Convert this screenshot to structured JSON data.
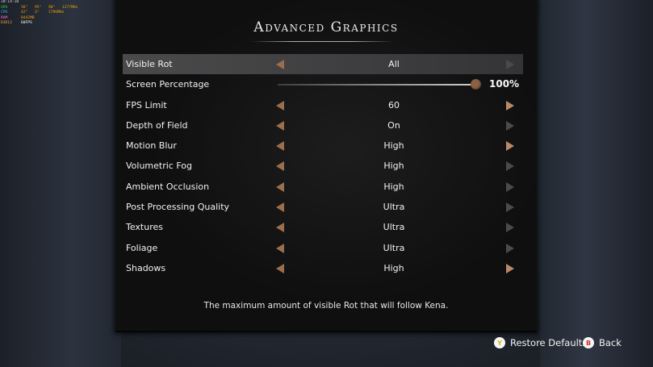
{
  "perf_overlay": {
    "clock": "20:14:10",
    "rows": [
      {
        "key": "GPU",
        "values": [
          "56°",
          "95°",
          "90°",
          "1277MHz"
        ]
      },
      {
        "key": "CPU",
        "values": [
          "42°",
          "3°",
          "1796MHz"
        ]
      },
      {
        "key": "RAM",
        "values": [
          "8442MB"
        ]
      },
      {
        "key": "D3D12",
        "values": [
          "60FPS"
        ]
      }
    ]
  },
  "title": "Advanced Graphics",
  "settings": [
    {
      "label": "Visible Rot",
      "value": "All"
    },
    {
      "label": "Screen Percentage",
      "value": "100%",
      "slider_fraction": 1.0
    },
    {
      "label": "FPS Limit",
      "value": "60"
    },
    {
      "label": "Depth of Field",
      "value": "On"
    },
    {
      "label": "Motion Blur",
      "value": "High"
    },
    {
      "label": "Volumetric Fog",
      "value": "High"
    },
    {
      "label": "Ambient Occlusion",
      "value": "High"
    },
    {
      "label": "Post Processing Quality",
      "value": "Ultra"
    },
    {
      "label": "Textures",
      "value": "Ultra"
    },
    {
      "label": "Foliage",
      "value": "Ultra"
    },
    {
      "label": "Shadows",
      "value": "High"
    }
  ],
  "selected_index": 0,
  "description": "The maximum amount of visible Rot that will follow Kena.",
  "footer": {
    "restore": {
      "glyph": "Y",
      "label": "Restore Defaults"
    },
    "back": {
      "glyph": "B",
      "label": "Back"
    }
  },
  "colors": {
    "arrow_accent": "#9a6f4e",
    "slider_thumb": "#8b6146",
    "panel_bg": "#0f0f10",
    "selected_row": "#4a4a4b"
  },
  "icons": {
    "left_arrow": "chevron-left-icon",
    "right_arrow": "chevron-right-icon",
    "restore_button": "controller-y-button-icon",
    "back_button": "controller-b-button-icon"
  }
}
